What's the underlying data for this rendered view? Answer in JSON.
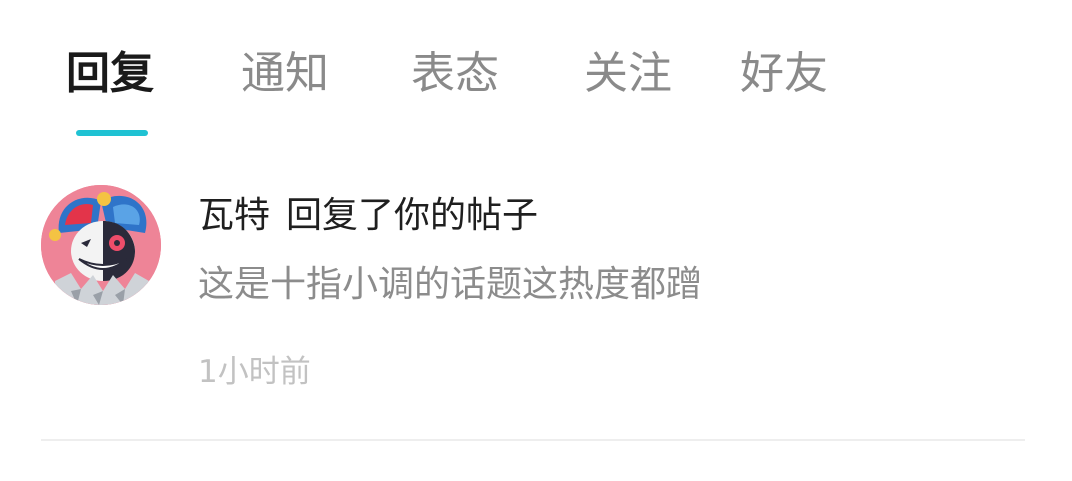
{
  "tabs": [
    {
      "label": "回复",
      "active": true
    },
    {
      "label": "通知",
      "active": false
    },
    {
      "label": "表态",
      "active": false
    },
    {
      "label": "关注",
      "active": false
    },
    {
      "label": "好友",
      "active": false
    }
  ],
  "accent_color": "#1fc2d3",
  "notifications": [
    {
      "avatar_icon": "jester-avatar-icon",
      "username": "瓦特",
      "action": "回复了你的帖子",
      "content": "这是十指小调的话题这热度都蹭",
      "time": "1小时前"
    }
  ]
}
